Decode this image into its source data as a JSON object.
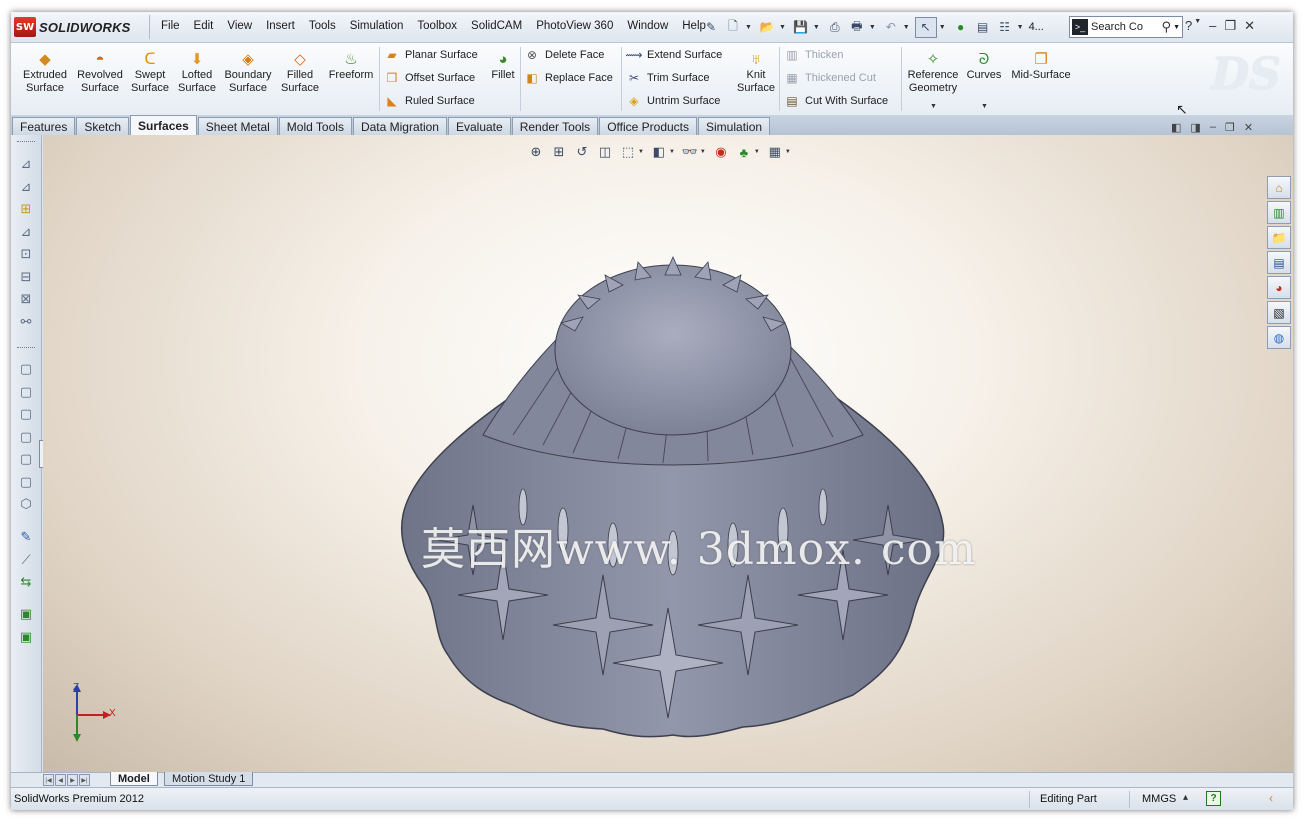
{
  "app": {
    "logo_mark": "SW",
    "logo_text": "SOLIDWORKS",
    "menu": [
      "File",
      "Edit",
      "View",
      "Insert",
      "Tools",
      "Simulation",
      "Toolbox",
      "SolidCAM",
      "PhotoView 360",
      "Window",
      "Help"
    ],
    "search_placeholder": "Search Co",
    "overflow_label": "4..."
  },
  "ribbon": {
    "big_buttons": [
      {
        "label": "Extruded\nSurface",
        "icon": "extruded-surface-icon"
      },
      {
        "label": "Revolved\nSurface",
        "icon": "revolved-surface-icon"
      },
      {
        "label": "Swept\nSurface",
        "icon": "swept-surface-icon"
      },
      {
        "label": "Lofted\nSurface",
        "icon": "lofted-surface-icon"
      },
      {
        "label": "Boundary\nSurface",
        "icon": "boundary-surface-icon"
      },
      {
        "label": "Filled\nSurface",
        "icon": "filled-surface-icon"
      },
      {
        "label": "Freeform",
        "icon": "freeform-icon"
      }
    ],
    "col1": [
      "Planar Surface",
      "Offset Surface",
      "Ruled Surface"
    ],
    "fillet": "Fillet",
    "col2": [
      "Delete Face",
      "Replace Face"
    ],
    "col3": [
      "Extend Surface",
      "Trim Surface",
      "Untrim Surface"
    ],
    "knit": "Knit\nSurface",
    "col4": [
      "Thicken",
      "Thickened Cut",
      "Cut With Surface"
    ],
    "reference_geometry": "Reference\nGeometry",
    "curves": "Curves",
    "mid_surface": "Mid-Surface"
  },
  "tabs": [
    "Features",
    "Sketch",
    "Surfaces",
    "Sheet Metal",
    "Mold Tools",
    "Data Migration",
    "Evaluate",
    "Render Tools",
    "Office Products",
    "Simulation"
  ],
  "active_tab": "Surfaces",
  "viewport": {
    "watermark": "莫西网www. 3dmox. com",
    "axis_z": "Z",
    "axis_x": "X"
  },
  "bottom_tabs": [
    "Model",
    "Motion Study 1"
  ],
  "status": {
    "product": "SolidWorks Premium 2012",
    "mode": "Editing Part",
    "units": "MMGS",
    "help": "?"
  },
  "colors": {
    "accent_red": "#c8281c",
    "ribbon_bg": "#eef2f7",
    "part_gray": "#8a8fa3"
  }
}
